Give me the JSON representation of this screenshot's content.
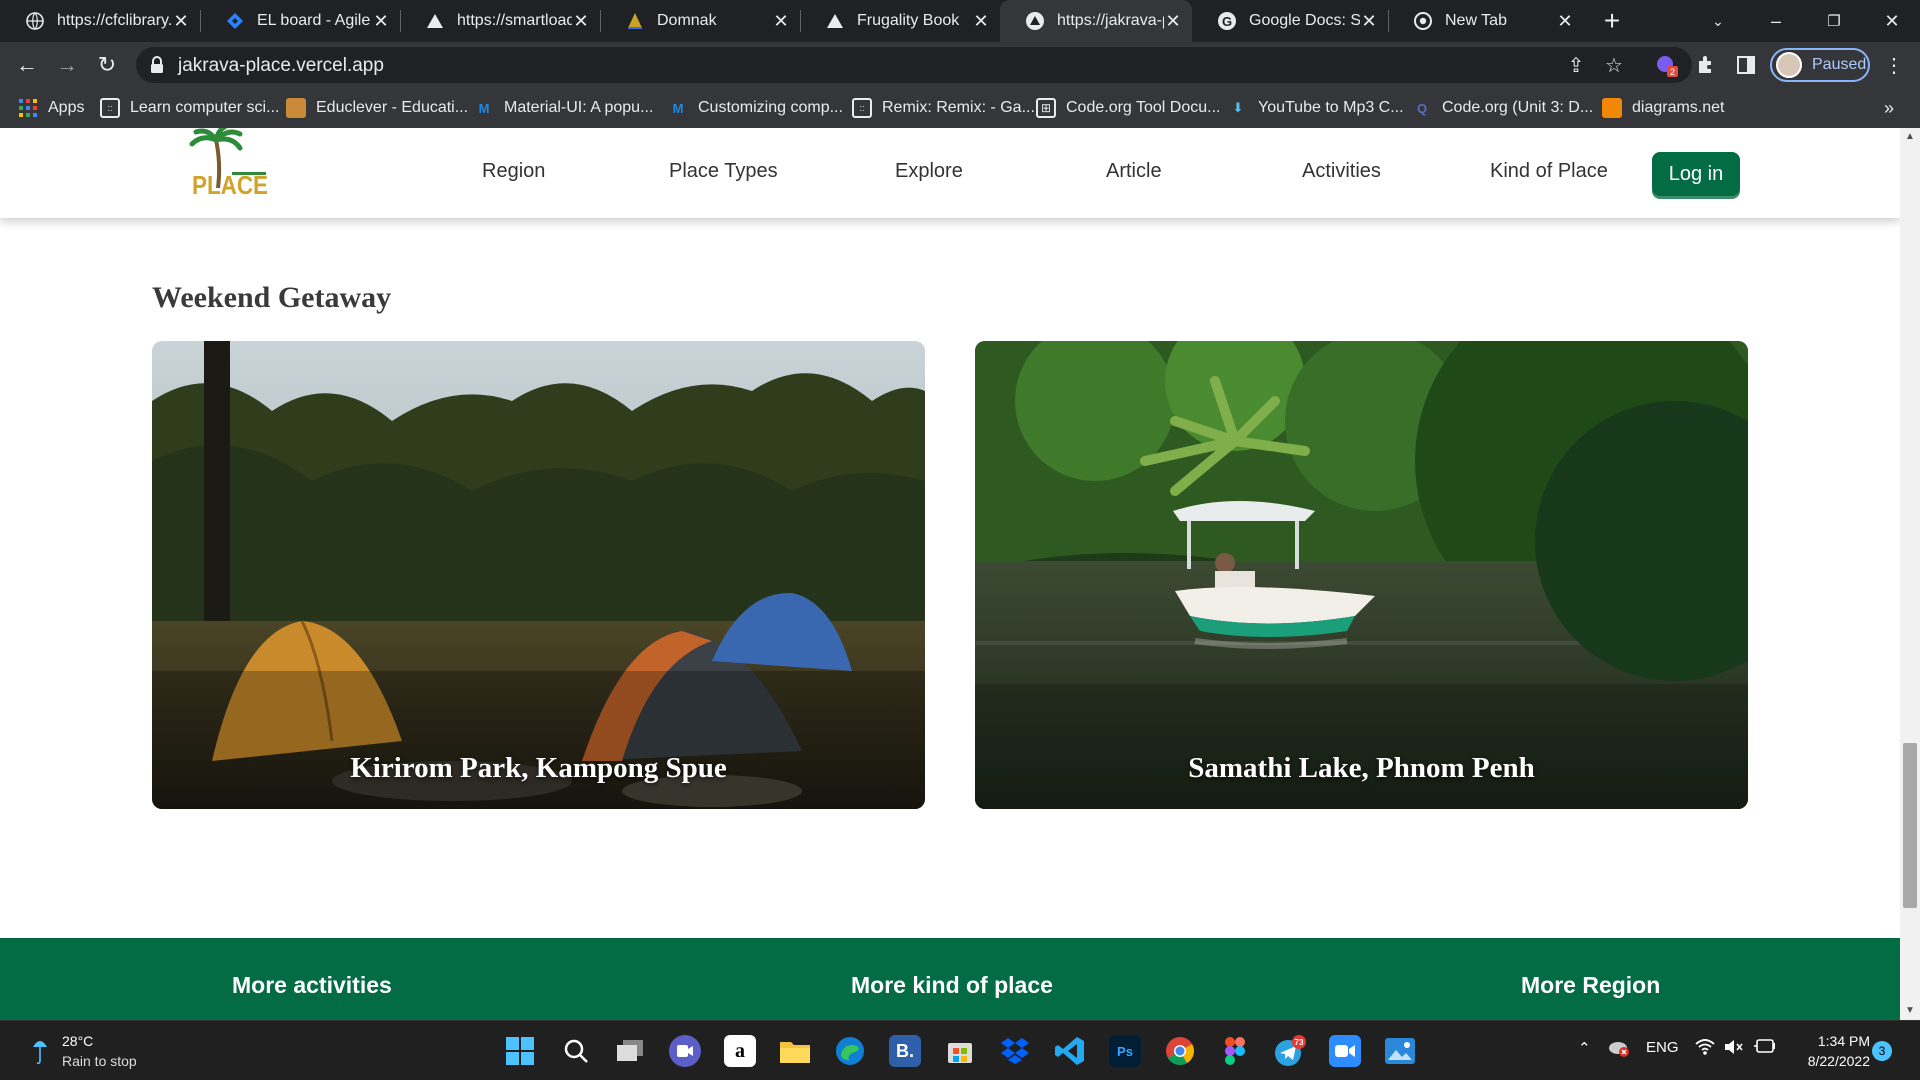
{
  "browser": {
    "tabs": [
      {
        "title": "https://cfclibrary.w",
        "icon": "globe-icon"
      },
      {
        "title": "EL board - Agile b",
        "icon": "jira-icon"
      },
      {
        "title": "https://smartload",
        "icon": "vercel-icon"
      },
      {
        "title": "Domnak",
        "icon": "domnak-icon"
      },
      {
        "title": "Frugality Book",
        "icon": "vercel-icon"
      },
      {
        "title": "https://jakrava-pl",
        "icon": "vercel-icon"
      },
      {
        "title": "Google Docs: Sign",
        "icon": "google-icon"
      },
      {
        "title": "New Tab",
        "icon": "chrome-icon"
      }
    ],
    "url": "jakrava-place.vercel.app",
    "profile_label": "Paused",
    "extension_badge": "2",
    "bookmarks": [
      {
        "label": "Apps",
        "icon": "apps-grid-icon"
      },
      {
        "label": "Learn computer sci...",
        "icon": "bookmark-site-icon"
      },
      {
        "label": "Educlever - Educati...",
        "icon": "bookmark-site-icon"
      },
      {
        "label": "Material-UI: A popu...",
        "icon": "mui-icon"
      },
      {
        "label": "Customizing comp...",
        "icon": "mui-icon"
      },
      {
        "label": "Remix: Remix: - Ga...",
        "icon": "bookmark-site-icon"
      },
      {
        "label": "Code.org Tool Docu...",
        "icon": "bookmark-site-icon"
      },
      {
        "label": "YouTube to Mp3 C...",
        "icon": "bookmark-site-icon"
      },
      {
        "label": "Code.org (Unit 3: D...",
        "icon": "bookmark-site-icon"
      },
      {
        "label": "diagrams.net",
        "icon": "diagrams-icon"
      }
    ],
    "more_bookmarks": "»"
  },
  "site": {
    "logo_text": "PLACE",
    "nav": [
      "Region",
      "Place Types",
      "Explore",
      "Article",
      "Activities",
      "Kind of Place"
    ],
    "login_label": "Log in",
    "section_title": "Weekend Getaway",
    "cards": [
      {
        "caption": "Kirirom Park, Kampong Spue"
      },
      {
        "caption": "Samathi Lake, Phnom Penh"
      }
    ],
    "footer_headings": [
      "More activities",
      "More kind of place",
      "More Region"
    ],
    "colors": {
      "brand_green": "#046c45"
    }
  },
  "taskbar": {
    "temperature": "28°C",
    "weather": "Rain to stop",
    "telegram_badge": "73",
    "language": "ENG",
    "time": "1:34 PM",
    "date": "8/22/2022",
    "notification_count": "3"
  }
}
